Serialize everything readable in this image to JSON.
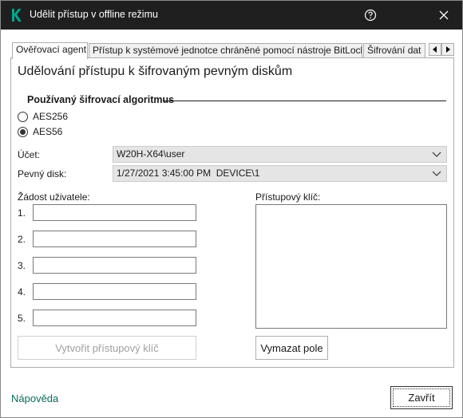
{
  "window": {
    "title": "Udělit přístup v offline režimu",
    "icons": {
      "logo": "kaspersky-k-icon",
      "help": "help-icon",
      "close": "close-icon"
    },
    "colors": {
      "titlebar": "#1f1f1f",
      "accent": "#0a6b5b",
      "logo": "#00a88e"
    }
  },
  "tabs": [
    {
      "label": "Ověřovací agent",
      "active": true
    },
    {
      "label": "Přístup k systémové jednotce chráněné pomocí nástroje BitLocker",
      "active": false
    },
    {
      "label": "Šifrování dat",
      "active": false
    }
  ],
  "panel": {
    "title": "Udělování přístupu k šifrovaným pevným diskům",
    "algorithm": {
      "label": "Používaný šifrovací algoritmus",
      "options": [
        {
          "label": "AES256",
          "selected": false
        },
        {
          "label": "AES56",
          "selected": true
        }
      ]
    },
    "account": {
      "label": "Účet:",
      "value": "W20H-X64\\user"
    },
    "disk": {
      "label": "Pevný disk:",
      "value": "1/27/2021 3:45:00 PM  DEVICE\\1"
    },
    "request": {
      "label": "Žádost uživatele:",
      "fields": [
        {
          "num": "1.",
          "value": ""
        },
        {
          "num": "2.",
          "value": ""
        },
        {
          "num": "3.",
          "value": ""
        },
        {
          "num": "4.",
          "value": ""
        },
        {
          "num": "5.",
          "value": ""
        }
      ]
    },
    "access_key": {
      "label": "Přístupový klíč:",
      "value": ""
    },
    "generate_button": "Vytvořit přístupový klíč",
    "clear_button": "Vymazat pole"
  },
  "footer": {
    "help_link": "Nápověda",
    "close_button": "Zavřít"
  }
}
